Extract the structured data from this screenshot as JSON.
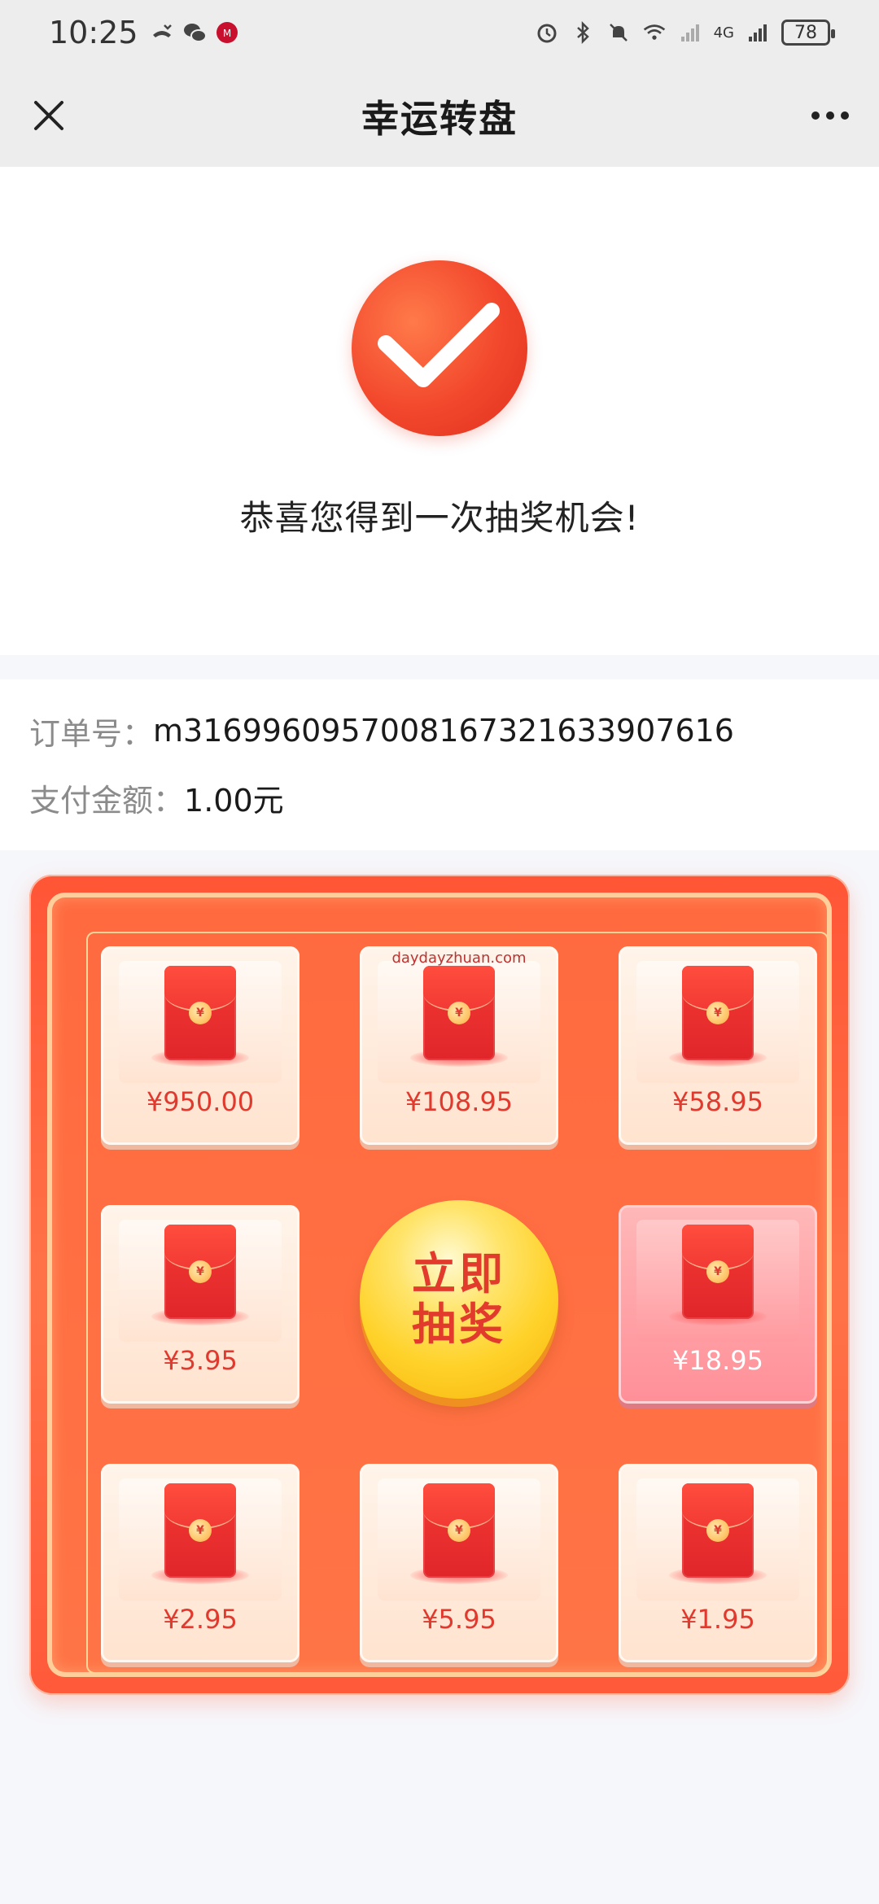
{
  "status_bar": {
    "time": "10:25",
    "network": "4G",
    "battery": "78"
  },
  "nav": {
    "title": "幸运转盘"
  },
  "success": {
    "message": "恭喜您得到一次抽奖机会!"
  },
  "order": {
    "order_label": "订单号：",
    "order_value": "m3169960957008167321633907616",
    "amount_label": "支付金额：",
    "amount_value": "1.00元"
  },
  "lottery": {
    "watermark": "daydayzhuan.com",
    "button_line1": "立即",
    "button_line2": "抽奖",
    "prizes": [
      {
        "price": "¥950.00"
      },
      {
        "price": "¥108.95"
      },
      {
        "price": "¥58.95"
      },
      {
        "price": "¥3.95"
      },
      {
        "price": "¥18.95"
      },
      {
        "price": "¥2.95"
      },
      {
        "price": "¥5.95"
      },
      {
        "price": "¥1.95"
      }
    ],
    "active_index": 4,
    "colors": {
      "board": "#ff6a3f",
      "active_cell": "#ff9aa2",
      "button": "#ffd22a",
      "price_text": "#e03a2f"
    }
  }
}
